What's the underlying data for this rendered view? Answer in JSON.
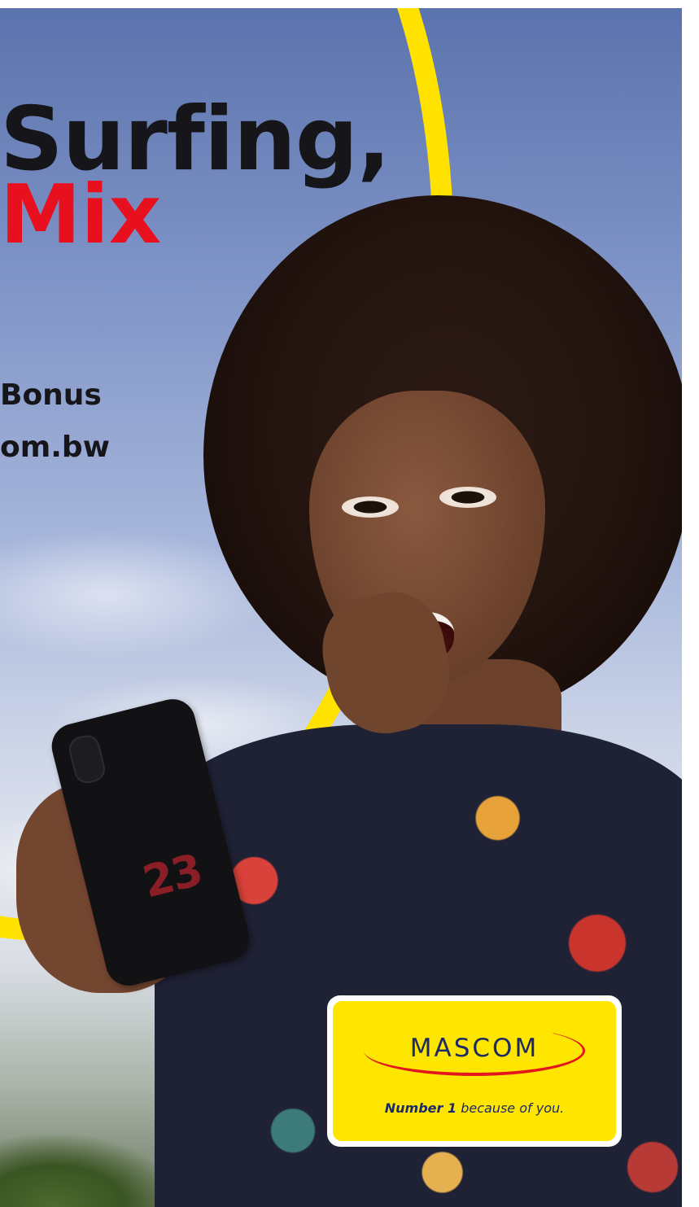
{
  "headline": {
    "line1": "Surfing,",
    "line2": "Mix"
  },
  "subtext": {
    "line1": "Bonus",
    "line2": "om.bw"
  },
  "phone": {
    "case_number": "23"
  },
  "logo": {
    "brand": "MASCOM",
    "tagline_bold": "Number 1",
    "tagline_rest": " because of you."
  },
  "colors": {
    "accent_yellow": "#ffe200",
    "accent_red": "#e8101e",
    "headline_dark": "#16161a",
    "brand_navy": "#1d2a63"
  }
}
